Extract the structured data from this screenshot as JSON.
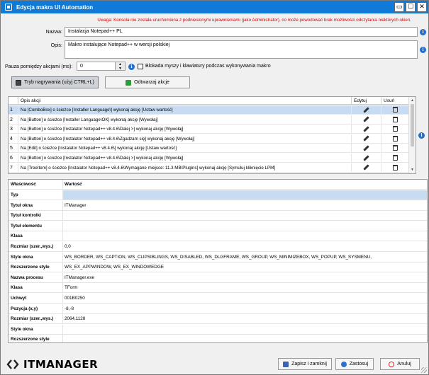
{
  "window": {
    "title": "Edycja makra UI Automation",
    "buttons": {
      "minimize": "▭",
      "maximize": "☐",
      "close": "✕"
    }
  },
  "warning": "Uwaga: Konsola nie została uruchomiona z podniesionymi uprawnieniami (jako Administrator), co może powodować brak możliwości odczytania niektórych okien.",
  "form": {
    "name_label": "Nazwa:",
    "name_value": "Instalacja Notepad++ PL",
    "desc_label": "Opis:",
    "desc_value": "Makro instalujące Notepad++ w wersji polskiej",
    "pause_label": "Pauza pomiędzy akcjami (ms):",
    "pause_value": "0",
    "block_label": "Blokada myszy i klawiatury podczas wykonywania makro"
  },
  "toolbar": {
    "record_label": "Tryb nagrywania (użyj CTRL+L)",
    "play_label": "Odtwarzaj akcje"
  },
  "actions_grid": {
    "columns": [
      "Opis akcji",
      "Edytuj",
      "Usuń"
    ],
    "rows": [
      {
        "num": "1",
        "desc": "Na [ComboBox] o ścieżce [Installer Language\\] wykonaj akcję [Ustaw wartość]"
      },
      {
        "num": "2",
        "desc": "Na [Button] o ścieżce [Installer Language\\OK] wykonaj akcję [Wywołaj]"
      },
      {
        "num": "3",
        "desc": "Na [Button] o ścieżce [Instalator Notepad++ v8.4.6\\Dalej >] wykonaj akcję [Wywołaj]"
      },
      {
        "num": "4",
        "desc": "Na [Button] o ścieżce [Instalator Notepad++ v8.4.6\\Zgadzam się] wykonaj akcję [Wywołaj]"
      },
      {
        "num": "5",
        "desc": "Na [Edit] o ścieżce [Instalator Notepad++ v8.4.6\\] wykonaj akcję [Ustaw wartość]"
      },
      {
        "num": "6",
        "desc": "Na [Button] o ścieżce [Instalator Notepad++ v8.4.6\\Dalej >] wykonaj akcję [Wywołaj]"
      },
      {
        "num": "7",
        "desc": "Na [TreeItem] o ścieżce [Instalator Notepad++ v8.4.6\\Wymagane miejsce: 11.3 MB\\Plugins] wykonaj akcję [Symuluj kliknięcie LPM]"
      }
    ]
  },
  "properties": {
    "header_key": "Właściwość",
    "header_value": "Wartość",
    "rows": [
      {
        "k": "Typ",
        "v": ""
      },
      {
        "k": "Tytuł okna",
        "v": "ITManager"
      },
      {
        "k": "Tytuł kontrolki",
        "v": ""
      },
      {
        "k": "Tytuł elementu",
        "v": ""
      },
      {
        "k": "Klasa",
        "v": ""
      },
      {
        "k": "Rozmiar (szer.,wys.)",
        "v": "0,0"
      },
      {
        "k": "Style okna",
        "v": "WS_BORDER, WS_CAPTION, WS_CLIPSIBLINGS, WS_DISABLED, WS_DLGFRAME, WS_GROUP, WS_MINIMIZEBOX, WS_POPUP, WS_SYSMENU,"
      },
      {
        "k": "Rozszerzone style",
        "v": "WS_EX_APPWINDOW, WS_EX_WINDOWEDGE"
      },
      {
        "k": "Nazwa procesu",
        "v": "ITManager.exe"
      },
      {
        "k": "Klasa",
        "v": "TForm"
      },
      {
        "k": "Uchwyt",
        "v": "001B0250"
      },
      {
        "k": "Pozycja (x,y)",
        "v": "-8,-8"
      },
      {
        "k": "Rozmiar (szer.,wys.)",
        "v": "2064,1128"
      },
      {
        "k": "Style okna",
        "v": ""
      },
      {
        "k": "Rozszerzone style",
        "v": ""
      }
    ]
  },
  "footer": {
    "logo_text": "ITMANAGER",
    "save_close_label": "Zapisz i zamknij",
    "apply_label": "Zastosuj",
    "cancel_label": "Anuluj"
  },
  "colors": {
    "titlebar": "#0f7ad7",
    "selection": "#c7dcf2",
    "warning": "#e00000"
  }
}
